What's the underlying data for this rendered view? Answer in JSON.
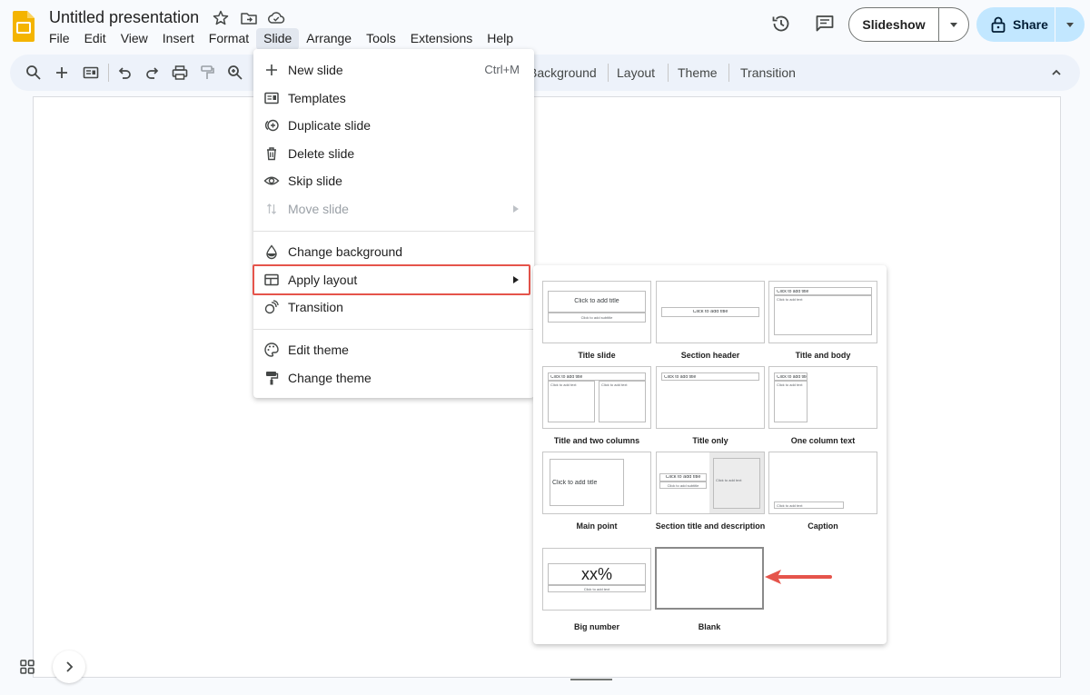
{
  "header": {
    "doc_title": "Untitled presentation",
    "menu": [
      "File",
      "Edit",
      "View",
      "Insert",
      "Format",
      "Slide",
      "Arrange",
      "Tools",
      "Extensions",
      "Help"
    ],
    "active_menu": "Slide",
    "slideshow_label": "Slideshow",
    "share_label": "Share"
  },
  "toolbar": {
    "background_label": "Background",
    "layout_label": "Layout",
    "theme_label": "Theme",
    "transition_label": "Transition"
  },
  "slide_menu": {
    "new_slide": "New slide",
    "new_slide_shortcut": "Ctrl+M",
    "templates": "Templates",
    "duplicate_slide": "Duplicate slide",
    "delete_slide": "Delete slide",
    "skip_slide": "Skip slide",
    "move_slide": "Move slide",
    "change_background": "Change background",
    "apply_layout": "Apply layout",
    "transition": "Transition",
    "edit_theme": "Edit theme",
    "change_theme": "Change theme"
  },
  "layouts": {
    "title_slide": {
      "name": "Title slide",
      "title": "Click to add title",
      "subtitle": "Click to add subtitle"
    },
    "section_header": {
      "name": "Section header",
      "title": "Click to add title"
    },
    "title_and_body": {
      "name": "Title and body",
      "title": "Click to add title",
      "body": "Click to add text"
    },
    "title_two_columns": {
      "name": "Title and two columns",
      "title": "Click to add title",
      "col1": "Click to add text",
      "col2": "Click to add text"
    },
    "title_only": {
      "name": "Title only",
      "title": "Click to add title"
    },
    "one_column_text": {
      "name": "One column text",
      "title": "Click to add title",
      "body": "Click to add text"
    },
    "main_point": {
      "name": "Main point",
      "title": "Click to add title"
    },
    "section_title_description": {
      "name": "Section title and description",
      "title": "Click to add title",
      "subtitle": "Click to add subtitle",
      "body": "Click to add text"
    },
    "caption": {
      "name": "Caption",
      "text": "Click to add text"
    },
    "big_number": {
      "name": "Big number",
      "number": "xx%",
      "text": "Click to add text"
    },
    "blank": {
      "name": "Blank"
    }
  },
  "colors": {
    "accent_highlight": "#e5544b",
    "share_bg": "#c2e7ff",
    "toolbar_bg": "#edf2fa",
    "logo": "#f4b400"
  },
  "icons": [
    "slides-logo-icon",
    "star-icon",
    "move-to-folder-icon",
    "cloud-saved-icon",
    "version-history-icon",
    "comments-icon",
    "lock-icon",
    "search-icon",
    "plus-icon",
    "new-slide-layout-icon",
    "undo-icon",
    "redo-icon",
    "print-icon",
    "paint-format-icon",
    "zoom-icon",
    "grid-view-icon",
    "chevron-right-icon",
    "chevron-up-icon"
  ]
}
